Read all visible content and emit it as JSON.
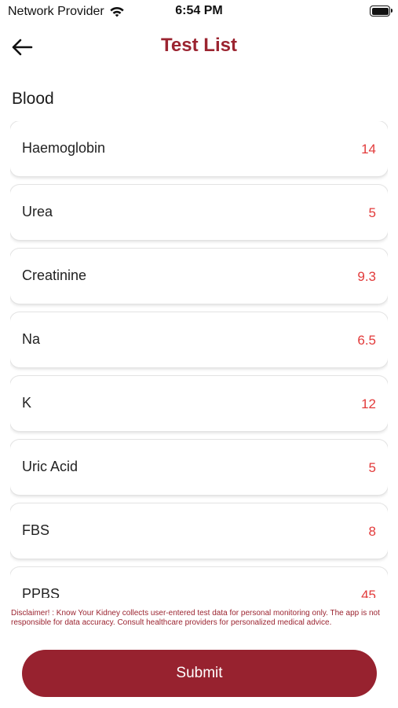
{
  "status_bar": {
    "carrier": "Network Provider",
    "time": "6:54 PM",
    "wifi_icon": "wifi-icon",
    "battery_icon": "battery-full-icon"
  },
  "header": {
    "back_icon": "arrow-left-icon",
    "title": "Test List"
  },
  "section": {
    "title": "Blood"
  },
  "tests": [
    {
      "name": "Haemoglobin",
      "value": "14"
    },
    {
      "name": "Urea",
      "value": "5"
    },
    {
      "name": "Creatinine",
      "value": "9.3"
    },
    {
      "name": "Na",
      "value": "6.5"
    },
    {
      "name": "K",
      "value": "12"
    },
    {
      "name": "Uric Acid",
      "value": "5"
    },
    {
      "name": "FBS",
      "value": "8"
    },
    {
      "name": "PPBS",
      "value": "45"
    }
  ],
  "disclaimer": "Disclaimer! : Know Your Kidney collects user-entered test data for personal monitoring only. The app is not responsible for data accuracy. Consult healthcare providers for personalized medical advice.",
  "submit_label": "Submit",
  "colors": {
    "accent": "#9b2430",
    "value_text": "#e23a3a",
    "button_bg": "#97222f"
  }
}
